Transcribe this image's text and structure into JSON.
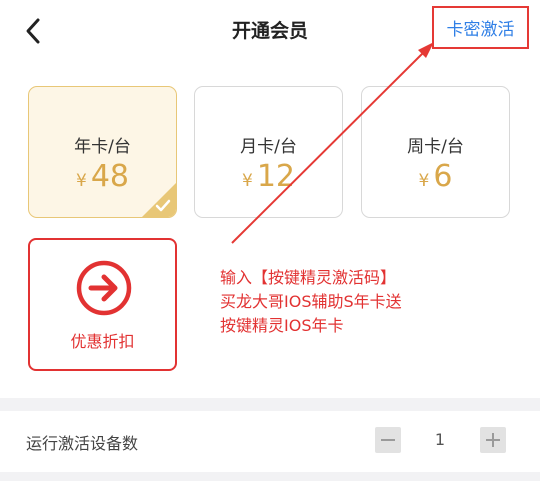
{
  "header": {
    "title": "开通会员",
    "activate_label": "卡密激活"
  },
  "plans": [
    {
      "name": "年卡/台",
      "currency": "¥",
      "price": "48",
      "selected": true
    },
    {
      "name": "月卡/台",
      "currency": "¥",
      "price": "12",
      "selected": false
    },
    {
      "name": "周卡/台",
      "currency": "¥",
      "price": "6",
      "selected": false
    }
  ],
  "discount": {
    "label": "优惠折扣"
  },
  "annotation": {
    "lines": [
      "输入【按键精灵激活码】",
      "买龙大哥IOS辅助S年卡送",
      "按键精灵IOS年卡"
    ]
  },
  "devices": {
    "label": "运行激活设备数",
    "value": "1"
  },
  "icons": [
    "chevron-left-icon",
    "checkmark-icon",
    "arrow-right-circle-icon",
    "minus-icon",
    "plus-icon"
  ],
  "colors": {
    "accent_gold": "#d9a74a",
    "selected_bg": "#fdf6e6",
    "annotation_red": "#e23232",
    "link_blue": "#2f7fe6"
  }
}
